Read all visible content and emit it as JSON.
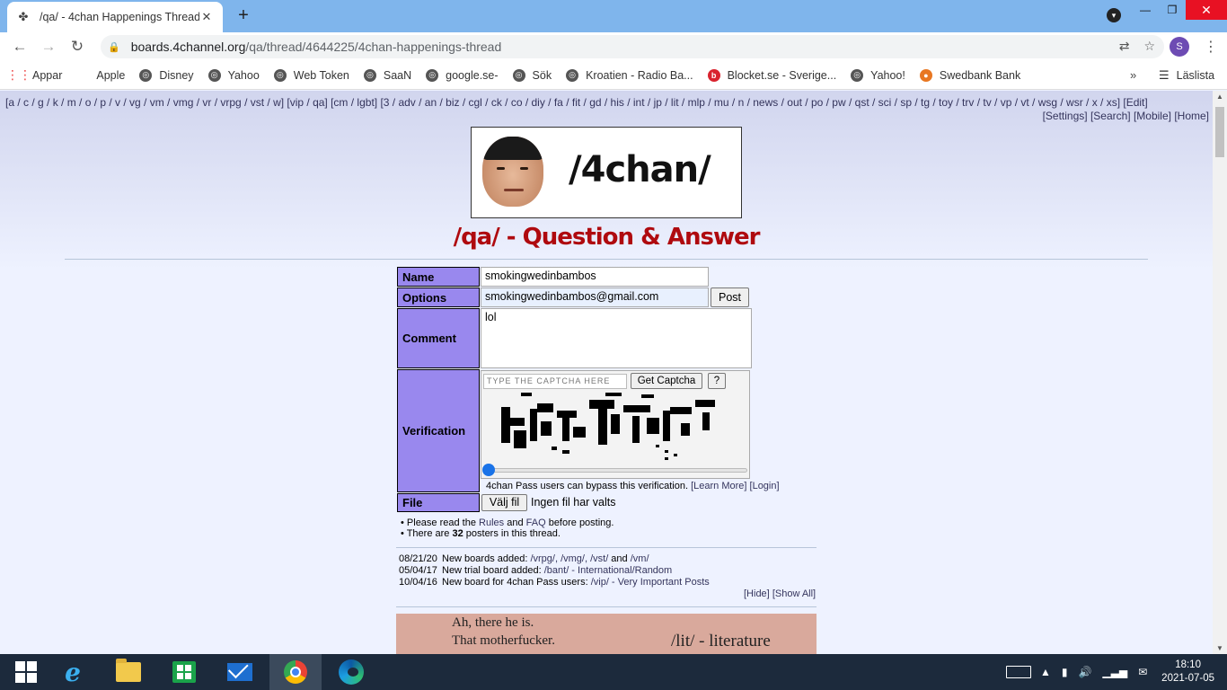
{
  "browser": {
    "tab_title": "/qa/ - 4chan Happenings Thread",
    "url_host": "boards.4channel.org",
    "url_path": "/qa/thread/4644225/4chan-happenings-thread",
    "profile_initial": "S",
    "bookmarks": [
      {
        "label": "Appar",
        "icon": "apps-grid-icon"
      },
      {
        "label": "Apple",
        "icon": "apple-icon"
      },
      {
        "label": "Disney",
        "icon": "globe-icon"
      },
      {
        "label": "Yahoo",
        "icon": "globe-icon"
      },
      {
        "label": "Web Token",
        "icon": "globe-icon"
      },
      {
        "label": "SaaN",
        "icon": "globe-icon"
      },
      {
        "label": "google.se-",
        "icon": "globe-icon"
      },
      {
        "label": "Sök",
        "icon": "globe-icon"
      },
      {
        "label": "Kroatien - Radio Ba...",
        "icon": "globe-icon"
      },
      {
        "label": "Blocket.se - Sverige...",
        "icon": "blocket-icon"
      },
      {
        "label": "Yahoo!",
        "icon": "globe-icon"
      },
      {
        "label": "Swedbank  Bank",
        "icon": "swedbank-icon"
      }
    ],
    "reading_list": "Läslista",
    "more": "»"
  },
  "boardnav": {
    "text": "[a / c / g / k / m / o / p / v / vg / vm / vmg / vr / vrpg / vst / w] [vip / qa] [cm / lgbt] [3 / adv / an / biz / cgl / ck / co / diy / fa / fit / gd / his / int / jp / lit / mlp / mu / n / news / out / po / pw / qst / sci / sp / tg / toy / trv / tv / vp / vt / wsg / wsr / x / xs] [Edit]",
    "right": "[Settings] [Search] [Mobile] [Home]"
  },
  "banner": {
    "text": "/4chan/"
  },
  "board_title": "/qa/ - Question & Answer",
  "postform": {
    "name_label": "Name",
    "name_value": "smokingwedinbambos",
    "options_label": "Options",
    "options_value": "smokingwedinbambos@gmail.com",
    "post_button": "Post",
    "comment_label": "Comment",
    "comment_value": "lol",
    "verification_label": "Verification",
    "captcha_placeholder": "TYPE THE CAPTCHA HERE",
    "get_captcha": "Get Captcha",
    "help": "?",
    "pass_note": "4chan Pass users can bypass this verification.",
    "learn_more": "[Learn More]",
    "login": "[Login]",
    "file_label": "File",
    "choose_file": "Välj fil",
    "no_file": "Ingen fil har valts"
  },
  "rules": {
    "line1_pre": "• Please read the ",
    "rules_link": "Rules",
    "and": " and ",
    "faq_link": "FAQ",
    "line1_post": " before posting.",
    "line2_pre": "• There are ",
    "poster_count": "32",
    "line2_post": " posters in this thread."
  },
  "news": [
    {
      "date": "08/21/20",
      "text": "New boards added: ",
      "link": "/vrpg/, /vmg/, /vst/",
      "mid": " and ",
      "link2": "/vm/"
    },
    {
      "date": "05/04/17",
      "text": "New trial board added: ",
      "link": "/bant/ - International/Random",
      "mid": "",
      "link2": ""
    },
    {
      "date": "10/04/16",
      "text": "New board for 4chan Pass users: ",
      "link": "/vip/ - Very Important Posts",
      "mid": "",
      "link2": ""
    }
  ],
  "hideshow": {
    "hide": "[Hide]",
    "show_all": "[Show All]"
  },
  "lit_banner": {
    "line1": "Ah, there he is.",
    "line2": "That motherfucker.",
    "label": "/lit/ - literature"
  },
  "taskbar": {
    "time": "18:10",
    "date": "2021-07-05"
  }
}
